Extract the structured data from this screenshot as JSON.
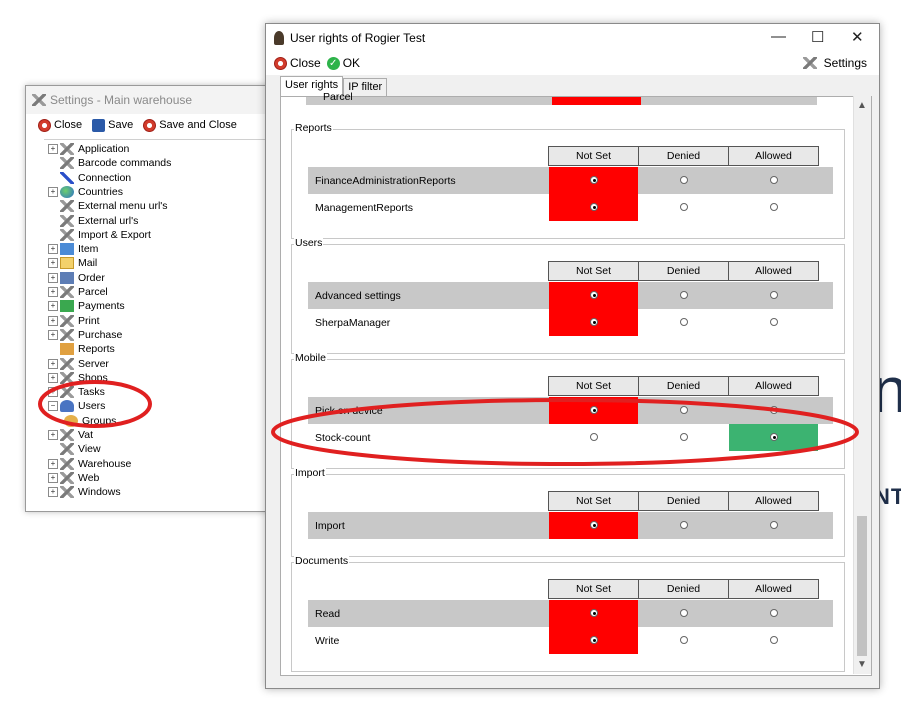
{
  "background": {
    "fragment_top": "n",
    "fragment_bottom": "NT"
  },
  "settings_window": {
    "title": "Settings - Main warehouse",
    "toolbar": {
      "close": "Close",
      "save": "Save",
      "save_close": "Save and Close"
    },
    "tree": [
      {
        "label": "Application",
        "icon": "tools-icon",
        "expandable": true
      },
      {
        "label": "Barcode commands",
        "icon": "tools-icon",
        "expandable": false
      },
      {
        "label": "Connection",
        "icon": "link-icon",
        "expandable": false
      },
      {
        "label": "Countries",
        "icon": "globe-icon",
        "expandable": true
      },
      {
        "label": "External menu url's",
        "icon": "tools-icon",
        "expandable": false
      },
      {
        "label": "External url's",
        "icon": "tools-icon",
        "expandable": false
      },
      {
        "label": "Import & Export",
        "icon": "tools-icon",
        "expandable": false
      },
      {
        "label": "Item",
        "icon": "item-icon",
        "expandable": true
      },
      {
        "label": "Mail",
        "icon": "mail-icon",
        "expandable": true
      },
      {
        "label": "Order",
        "icon": "order-icon",
        "expandable": true
      },
      {
        "label": "Parcel",
        "icon": "tools-icon",
        "expandable": true
      },
      {
        "label": "Payments",
        "icon": "payments-icon",
        "expandable": true
      },
      {
        "label": "Print",
        "icon": "tools-icon",
        "expandable": true
      },
      {
        "label": "Purchase",
        "icon": "tools-icon",
        "expandable": true
      },
      {
        "label": "Reports",
        "icon": "reports-icon",
        "expandable": false
      },
      {
        "label": "Server",
        "icon": "tools-icon",
        "expandable": true
      },
      {
        "label": "Shops",
        "icon": "tools-icon",
        "expandable": true
      },
      {
        "label": "Tasks",
        "icon": "tools-icon",
        "expandable": true
      },
      {
        "label": "Users",
        "icon": "users-icon",
        "expandable": true,
        "expanded": true
      },
      {
        "label": "Groups",
        "icon": "groups-icon",
        "expandable": false,
        "child": true
      },
      {
        "label": "Vat",
        "icon": "tools-icon",
        "expandable": true
      },
      {
        "label": "View",
        "icon": "tools-icon",
        "expandable": false
      },
      {
        "label": "Warehouse",
        "icon": "tools-icon",
        "expandable": true
      },
      {
        "label": "Web",
        "icon": "tools-icon",
        "expandable": true
      },
      {
        "label": "Windows",
        "icon": "tools-icon",
        "expandable": true
      }
    ]
  },
  "rights_window": {
    "title": "User rights of Rogier Test",
    "toolbar": {
      "close": "Close",
      "ok": "OK",
      "settings": "Settings"
    },
    "tabs": [
      "User rights",
      "IP filter"
    ],
    "top_partial_row": "Parcel",
    "columns": [
      "Not Set",
      "Denied",
      "Allowed"
    ],
    "groups": [
      {
        "title": "Reports",
        "rows": [
          {
            "label": "FinanceAdministrationReports",
            "value": "Not Set"
          },
          {
            "label": "ManagementReports",
            "value": "Not Set"
          }
        ]
      },
      {
        "title": "Users",
        "rows": [
          {
            "label": "Advanced settings",
            "value": "Not Set"
          },
          {
            "label": "SherpaManager",
            "value": "Not Set"
          }
        ]
      },
      {
        "title": "Mobile",
        "rows": [
          {
            "label": "Pick on device",
            "value": "Not Set"
          },
          {
            "label": "Stock-count",
            "value": "Allowed"
          }
        ]
      },
      {
        "title": "Import",
        "rows": [
          {
            "label": "Import",
            "value": "Not Set"
          }
        ]
      },
      {
        "title": "Documents",
        "rows": [
          {
            "label": "Read",
            "value": "Not Set"
          },
          {
            "label": "Write",
            "value": "Not Set"
          }
        ]
      }
    ],
    "colors": {
      "not_set": "#ff0000",
      "allowed": "#3cb371",
      "row_alt": "#c8c8c8"
    }
  },
  "annotations": {
    "color": "#e02020"
  }
}
